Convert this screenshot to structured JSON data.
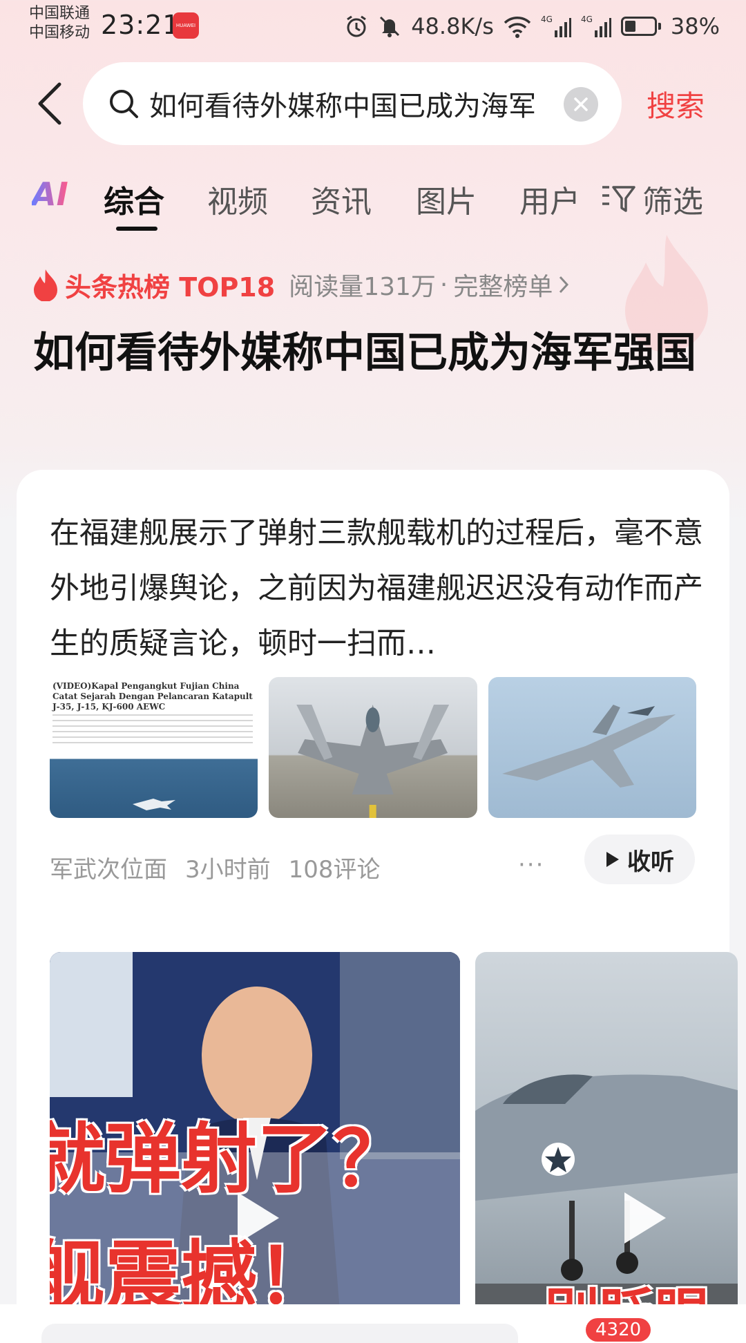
{
  "status_bar": {
    "carrier_1": "中国联通",
    "carrier_2": "中国移动",
    "time": "23:21",
    "brand_badge": "HUAWEI",
    "net_speed": "48.8K/s",
    "signal_1": "4G",
    "signal_2": "4G",
    "battery": "38%",
    "battery_level": 0.38,
    "icons": [
      "alarm-icon",
      "mute-icon",
      "wifi-icon",
      "signal-icon",
      "battery-icon"
    ]
  },
  "search": {
    "query": "如何看待外媒称中国已成为海军强国",
    "submit_label": "搜索"
  },
  "tabs": {
    "ai_label": "AI",
    "items": [
      "综合",
      "视频",
      "资讯",
      "图片",
      "用户"
    ],
    "active_index": 0,
    "filter_label": "筛选"
  },
  "hot": {
    "label": "头条热榜 TOP18",
    "reads": "阅读量131万",
    "separator": "·",
    "full_list": "完整榜单",
    "title": "如何看待外媒称中国已成为海军强国"
  },
  "article": {
    "snippet": "在福建舰展示了弹射三款舰载机的过程后，毫不意外地引爆舆论，之前因为福建舰迟迟没有动作而产生的质疑言论，顿时一扫而…",
    "thumb_news_headline": "(VIDEO)Kapal Pengangkut Fujian China Catat Sejarah Dengan Pelancaran Katapult J-35, J-15, KJ-600 AEWC",
    "source": "军武次位面",
    "time_ago": "3小时前",
    "comments": "108评论",
    "more": "···",
    "listen_label": "收听"
  },
  "videos": [
    {
      "overlay_line_1": "就弹射了？",
      "overlay_line_2": "舰震撼！"
    },
    {
      "overlay_line_1": "别眨眼"
    }
  ],
  "bottom": {
    "comment_count": "4320"
  },
  "colors": {
    "accent": "#f04142",
    "text_primary": "#111111",
    "text_secondary": "#888888"
  }
}
